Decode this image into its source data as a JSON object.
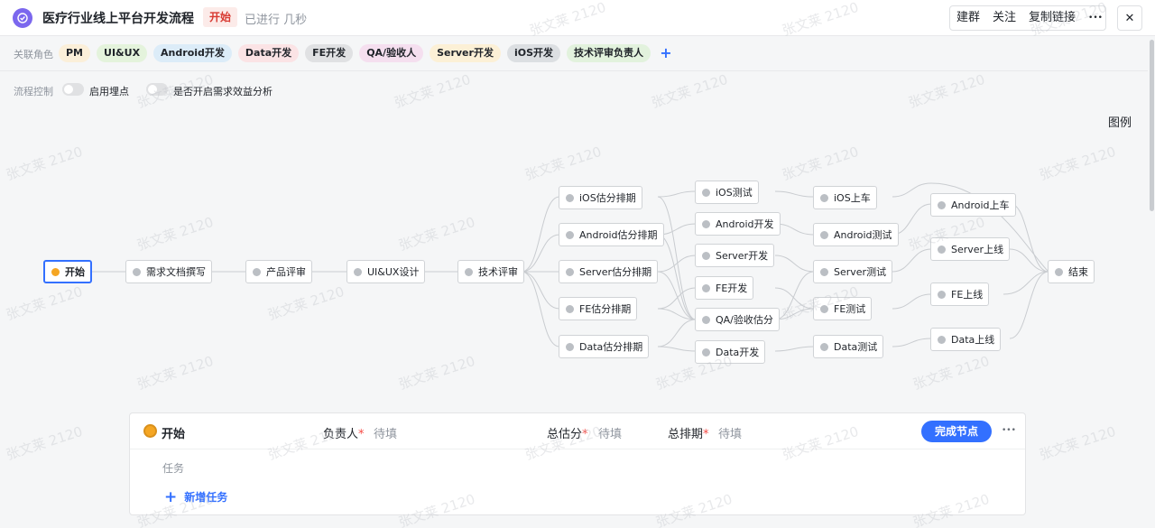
{
  "header": {
    "title": "医疗行业线上平台开发流程",
    "status": "开始",
    "elapsed": "已进行 几秒",
    "buttons": [
      "建群",
      "关注",
      "复制链接"
    ],
    "more_label": "•••",
    "close_label": "✕"
  },
  "roles": {
    "label": "关联角色",
    "items": [
      {
        "label": "PM",
        "color": "#fbefd9"
      },
      {
        "label": "UI&UX",
        "color": "#e4f3dc"
      },
      {
        "label": "Android开发",
        "color": "#dcecf8"
      },
      {
        "label": "Data开发",
        "color": "#fbe3e5"
      },
      {
        "label": "FE开发",
        "color": "#e0e1e3"
      },
      {
        "label": "QA/验收人",
        "color": "#f5dfef"
      },
      {
        "label": "Server开发",
        "color": "#fcf0d6"
      },
      {
        "label": "iOS开发",
        "color": "#dcdfe2"
      },
      {
        "label": "技术评审负责人",
        "color": "#e2f2dd"
      }
    ],
    "add_label": "+"
  },
  "flow_control": {
    "label": "流程控制",
    "toggles": [
      {
        "label": "启用埋点",
        "on": false
      },
      {
        "label": "是否开启需求效益分析",
        "on": false
      }
    ],
    "legend_label": "图例"
  },
  "nodes": {
    "start": "开始",
    "doc": "需求文档撰写",
    "review": "产品评审",
    "uiux": "UI&UX设计",
    "tech": "技术评审",
    "ios_est": "iOS估分排期",
    "android_est": "Android估分排期",
    "server_est": "Server估分排期",
    "fe_est": "FE估分排期",
    "data_est": "Data估分排期",
    "ios_test": "iOS测试",
    "android_dev": "Android开发",
    "server_dev": "Server开发",
    "fe_dev": "FE开发",
    "qa_est": "QA/验收估分",
    "data_dev": "Data开发",
    "ios_ship": "iOS上车",
    "android_test": "Android测试",
    "server_test": "Server测试",
    "fe_test": "FE测试",
    "data_test": "Data测试",
    "android_ship": "Android上车",
    "server_live": "Server上线",
    "fe_live": "FE上线",
    "data_live": "Data上线",
    "end": "结束"
  },
  "panel": {
    "title": "开始",
    "owner_label": "负责人",
    "owner_value": "待填",
    "estimate_label": "总估分",
    "estimate_value": "待填",
    "schedule_label": "总排期",
    "schedule_value": "待填",
    "required_mark": "*",
    "complete_button": "完成节点",
    "more_label": "•••",
    "task_label": "任务",
    "add_task_label": "新增任务",
    "add_task_plus": "+"
  },
  "watermark": "张文莱 2120",
  "colors": {
    "accent": "#3370ff",
    "start_dot": "#f5a623",
    "status_red": "#d83931",
    "app_icon": "#7b67ee"
  }
}
